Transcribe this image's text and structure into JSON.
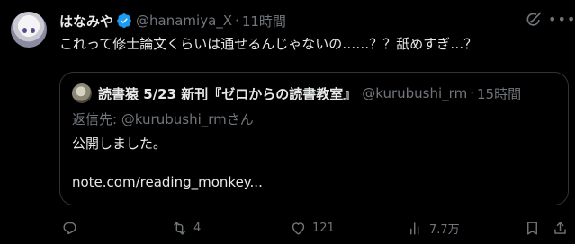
{
  "author": {
    "display_name": "はなみや",
    "handle": "@hanamiya_X",
    "separator": "·",
    "time": "11時間"
  },
  "tweet": {
    "text": "これって修士論文くらいは通せるんじゃないの……？？舐めすぎ…？"
  },
  "quote": {
    "display_name": "読書猿 5/23 新刊『ゼロからの読書教室』",
    "handle": "@kurubushi_rm",
    "separator": "·",
    "time": "15時間",
    "reply_prefix": "返信先: ",
    "reply_handle": "@kurubushi_rmさん",
    "line1": "公開しました。",
    "line2": "note.com/reading_monkey..."
  },
  "actions": {
    "reply_count": "",
    "retweet_count": "4",
    "like_count": "121",
    "views_count": "7.7万"
  },
  "icons": {
    "verified": "verified-badge-icon",
    "grok": "grok-icon",
    "more": "more-icon",
    "reply": "reply-icon",
    "retweet": "retweet-icon",
    "like": "heart-icon",
    "views": "views-icon",
    "bookmark": "bookmark-icon",
    "share": "share-icon"
  },
  "colors": {
    "background": "#000000",
    "text": "#e7e9ea",
    "muted": "#71767b",
    "border": "#2f3336",
    "verified": "#1d9bf0"
  }
}
